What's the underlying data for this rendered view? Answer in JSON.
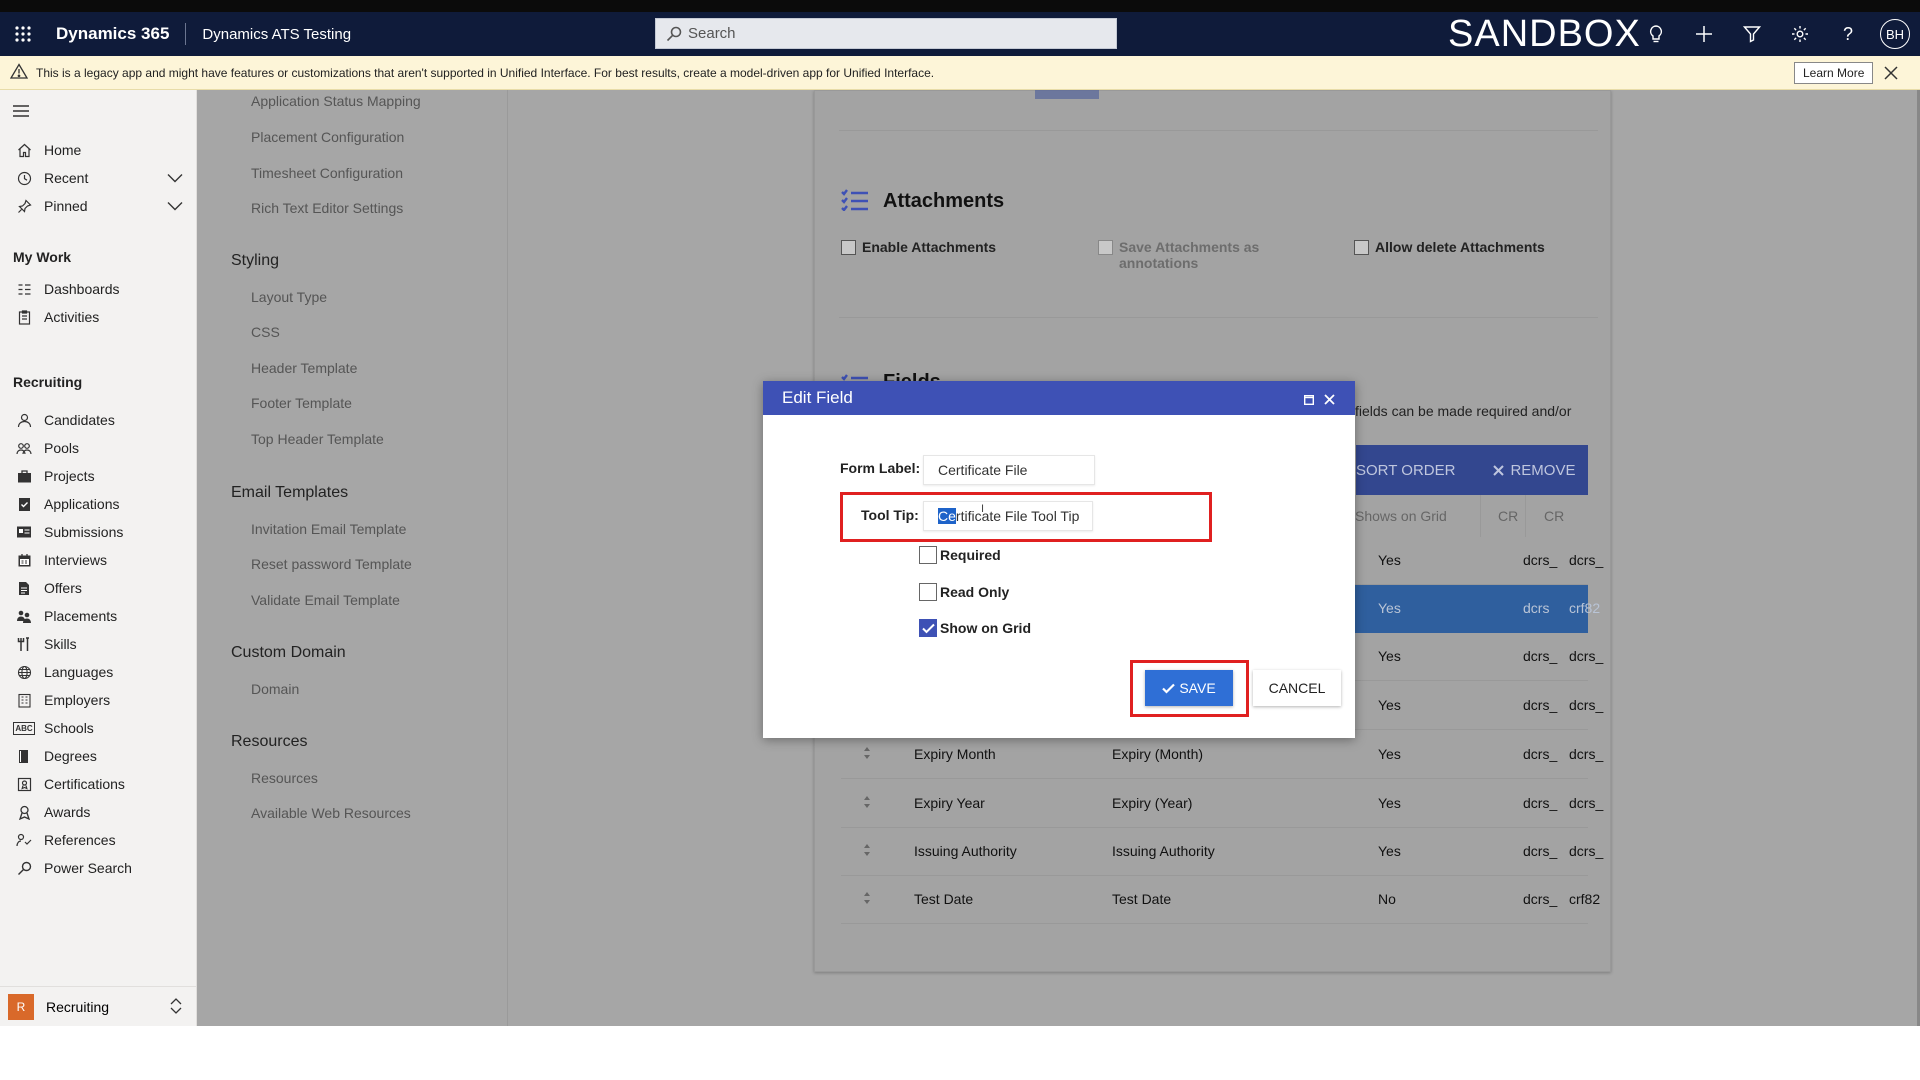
{
  "nav": {
    "brand": "Dynamics 365",
    "app_name": "Dynamics ATS Testing",
    "search_placeholder": "Search",
    "environment_label": "SANDBOX",
    "avatar_initials": "BH",
    "icons": [
      "lightbulb-icon",
      "plus-icon",
      "filter-icon",
      "gear-icon",
      "help-icon"
    ]
  },
  "banner": {
    "message": "This is a legacy app and might have features or customizations that aren't supported in Unified Interface. For best results, create a model-driven app for Unified Interface.",
    "learn_more_label": "Learn More"
  },
  "sidebar": {
    "items_top": [
      {
        "label": "Home",
        "icon": "home-icon"
      },
      {
        "label": "Recent",
        "icon": "clock-icon"
      },
      {
        "label": "Pinned",
        "icon": "pin-icon"
      }
    ],
    "my_work_header": "My Work",
    "my_work": [
      {
        "label": "Dashboards",
        "icon": "dashboard-icon"
      },
      {
        "label": "Activities",
        "icon": "clipboard-icon"
      }
    ],
    "recruiting_header": "Recruiting",
    "recruiting": [
      {
        "label": "Candidates",
        "icon": "person-icon"
      },
      {
        "label": "Pools",
        "icon": "people-icon"
      },
      {
        "label": "Projects",
        "icon": "briefcase-icon"
      },
      {
        "label": "Applications",
        "icon": "checklist-icon"
      },
      {
        "label": "Submissions",
        "icon": "card-icon"
      },
      {
        "label": "Interviews",
        "icon": "calendar-icon"
      },
      {
        "label": "Offers",
        "icon": "document-icon"
      },
      {
        "label": "Placements",
        "icon": "group-icon"
      },
      {
        "label": "Skills",
        "icon": "tools-icon"
      },
      {
        "label": "Languages",
        "icon": "globe-icon"
      },
      {
        "label": "Employers",
        "icon": "building-icon"
      },
      {
        "label": "Schools",
        "icon": "abc-icon"
      },
      {
        "label": "Degrees",
        "icon": "book-icon"
      },
      {
        "label": "Certifications",
        "icon": "certificate-icon"
      },
      {
        "label": "Awards",
        "icon": "award-icon"
      },
      {
        "label": "References",
        "icon": "reference-icon"
      },
      {
        "label": "Power Search",
        "icon": "search-icon"
      }
    ],
    "area_switcher": {
      "badge": "R",
      "label": "Recruiting"
    }
  },
  "settings_menu": {
    "top_links": [
      "Application Status Mapping",
      "Placement Configuration",
      "Timesheet Configuration",
      "Rich Text Editor Settings"
    ],
    "groups": [
      {
        "title": "Styling",
        "links": [
          "Layout Type",
          "CSS",
          "Header Template",
          "Footer Template",
          "Top Header Template"
        ]
      },
      {
        "title": "Email Templates",
        "links": [
          "Invitation Email Template",
          "Reset password Template",
          "Validate Email Template"
        ]
      },
      {
        "title": "Custom Domain",
        "links": [
          "Domain"
        ]
      },
      {
        "title": "Resources",
        "links": [
          "Resources",
          "Available Web Resources"
        ]
      }
    ]
  },
  "attachments": {
    "title": "Attachments",
    "enable_label": "Enable Attachments",
    "save_as_annotations_label": "Save Attachments as annotations",
    "allow_delete_label": "Allow delete Attachments"
  },
  "fields": {
    "title": "Fields",
    "description_fragment": "fields can be made required and/or",
    "toolbar": {
      "sort_label": "SORT ORDER",
      "remove_label": "REMOVE"
    },
    "columns": {
      "shows_on_grid": "Shows on Grid",
      "cr1": "CR",
      "cr2": "CR"
    },
    "rows": [
      {
        "name": "",
        "label": "",
        "shows": "Yes",
        "cr1": "dcrs_",
        "cr2": "dcrs_"
      },
      {
        "name": "",
        "label": "",
        "shows": "Yes",
        "cr1": "dcrs",
        "cr2": "crf82",
        "selected": true
      },
      {
        "name": "",
        "label": "",
        "shows": "Yes",
        "cr1": "dcrs_",
        "cr2": "dcrs_"
      },
      {
        "name": "",
        "label": "",
        "shows": "Yes",
        "cr1": "dcrs_",
        "cr2": "dcrs_"
      },
      {
        "name": "Expiry Month",
        "label": "Expiry (Month)",
        "shows": "Yes",
        "cr1": "dcrs_",
        "cr2": "dcrs_"
      },
      {
        "name": "Expiry Year",
        "label": "Expiry (Year)",
        "shows": "Yes",
        "cr1": "dcrs_",
        "cr2": "dcrs_"
      },
      {
        "name": "Issuing Authority",
        "label": "Issuing Authority",
        "shows": "Yes",
        "cr1": "dcrs_",
        "cr2": "dcrs_"
      },
      {
        "name": "Test Date",
        "label": "Test Date",
        "shows": "No",
        "cr1": "dcrs_",
        "cr2": "crf82"
      }
    ]
  },
  "dialog": {
    "title": "Edit Field",
    "form_label_caption": "Form Label:",
    "form_label_value": "Certificate File",
    "tooltip_caption": "Tool Tip:",
    "tooltip_selected": "Ce",
    "tooltip_rest": "rtificate File Tool Tip",
    "required_label": "Required",
    "required_checked": false,
    "readonly_label": "Read Only",
    "readonly_checked": false,
    "show_on_grid_label": "Show on Grid",
    "show_on_grid_checked": true,
    "save_label": "SAVE",
    "cancel_label": "CANCEL"
  },
  "colors": {
    "nav_bg": "#0f1b3a",
    "dialog_header": "#3e51b5",
    "save_button": "#2f6fd6",
    "highlight_box": "#e02020",
    "area_badge": "#d9692a"
  }
}
